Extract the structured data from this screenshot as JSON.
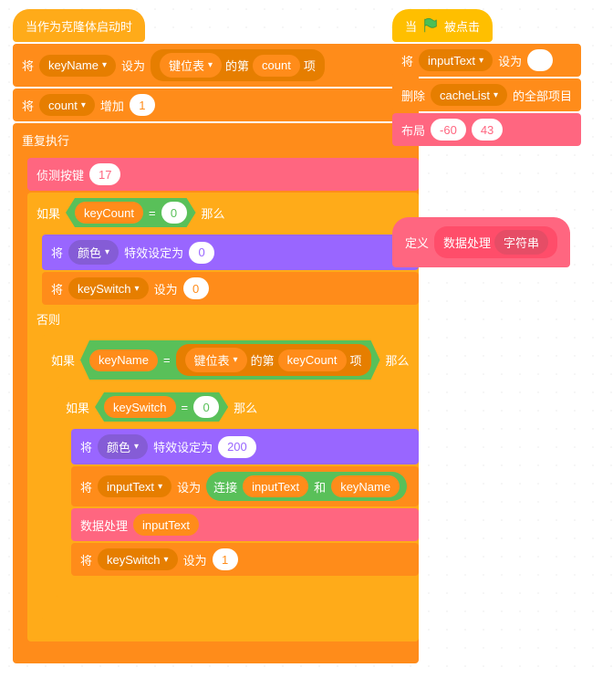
{
  "left": {
    "hat": "当作为克隆体启动时",
    "set": "将",
    "setTo": "设为",
    "keyName": "keyName",
    "keyTable": "键位表",
    "de_di": "的第",
    "count": "count",
    "xiang": "项",
    "change": "增加",
    "one": "1",
    "forever": "重复执行",
    "detectKey": "侦测按键",
    "seventeen": "17",
    "if": "如果",
    "then": "那么",
    "else": "否则",
    "keyCount": "keyCount",
    "eq": "=",
    "zero": "0",
    "colorVar": "颜色",
    "effectSet": "特效设定为",
    "keySwitch": "keySwitch",
    "twoHundred": "200",
    "inputText": "inputText",
    "join": "连接",
    "and": "和",
    "dataProc": "数据处理",
    "oneVal": "1"
  },
  "right1": {
    "when": "当",
    "clicked": "被点击",
    "set": "将",
    "inputText": "inputText",
    "setTo": "设为",
    "delete": "删除",
    "cacheList": "cacheList",
    "allItems": "的全部项目",
    "goto": "布局",
    "x": "-60",
    "y": "43"
  },
  "right2": {
    "define": "定义",
    "dataProc": "数据处理",
    "strParam": "字符串"
  }
}
